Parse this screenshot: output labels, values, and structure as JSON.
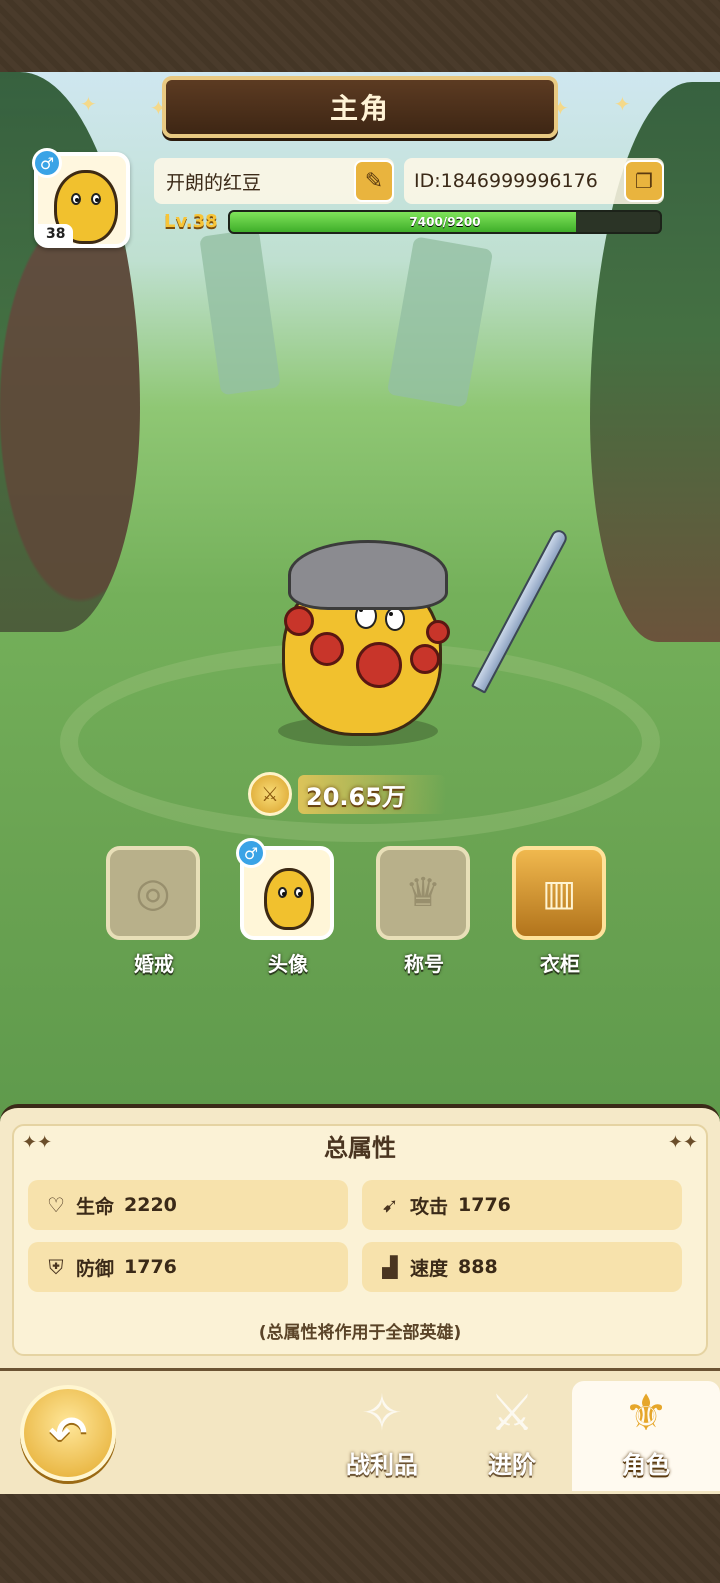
{
  "header": {
    "title": "主角"
  },
  "profile": {
    "gender_symbol": "♂",
    "avatar_level": "38",
    "name": "开朗的红豆",
    "id_text": "ID:1846999996176",
    "level_label": "Lv.38",
    "xp_text": "7400/9200",
    "xp_fraction": 0.8043
  },
  "power": {
    "value": "20.65万"
  },
  "features": [
    {
      "label": "婚戒",
      "icon": "ring-icon",
      "state": "locked"
    },
    {
      "label": "头像",
      "icon": "avatar-icon",
      "state": "active"
    },
    {
      "label": "称号",
      "icon": "crown-icon",
      "state": "locked"
    },
    {
      "label": "衣柜",
      "icon": "wardrobe-icon",
      "state": "available"
    }
  ],
  "stats": {
    "title": "总属性",
    "items": [
      {
        "name": "生命",
        "value": "2220",
        "icon": "heart-icon"
      },
      {
        "name": "攻击",
        "value": "1776",
        "icon": "attack-icon"
      },
      {
        "name": "防御",
        "value": "1776",
        "icon": "shield-icon"
      },
      {
        "name": "速度",
        "value": "888",
        "icon": "boot-icon"
      }
    ],
    "note": "(总属性将作用于全部英雄)"
  },
  "nav": {
    "tabs": [
      {
        "label": "战利品",
        "icon": "loot-icon",
        "selected": false
      },
      {
        "label": "进阶",
        "icon": "sword-badge-icon",
        "selected": false
      },
      {
        "label": "角色",
        "icon": "keyhole-crest-icon",
        "selected": true
      }
    ]
  },
  "colors": {
    "accent": "#e9b43e",
    "xp": "#3fae2a",
    "gender": "#3aa3e6"
  }
}
